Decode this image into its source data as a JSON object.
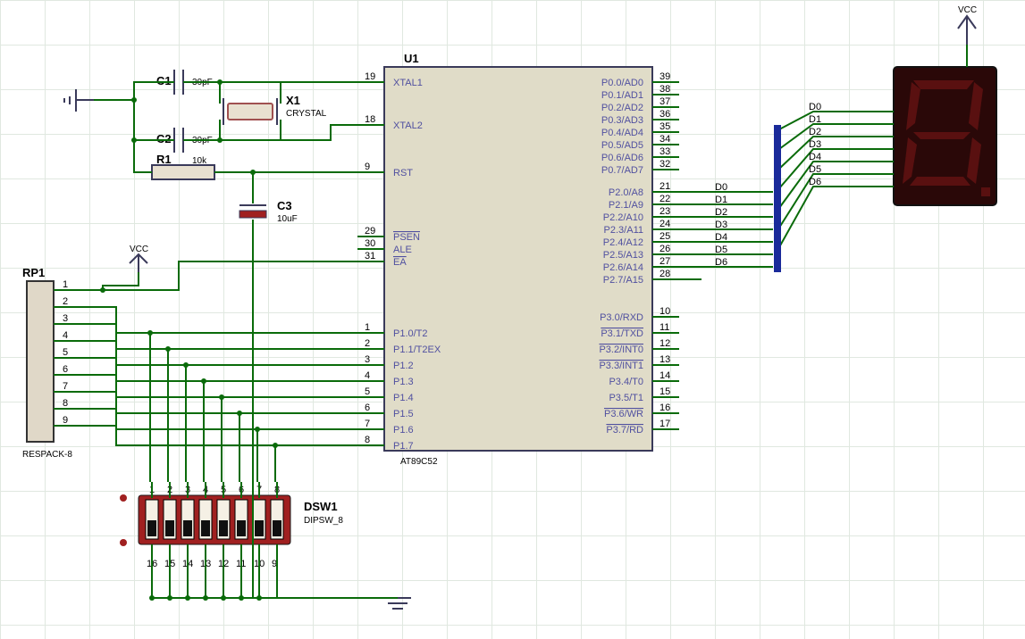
{
  "power": {
    "vcc_top": "VCC",
    "vcc_left": "VCC"
  },
  "mcu": {
    "ref": "U1",
    "part": "AT89C52",
    "left_pins": [
      {
        "num": "19",
        "name": "XTAL1"
      },
      {
        "num": "18",
        "name": "XTAL2"
      },
      {
        "num": "9",
        "name": "RST"
      },
      {
        "num": "29",
        "name": "PSEN",
        "ov": true
      },
      {
        "num": "30",
        "name": "ALE"
      },
      {
        "num": "31",
        "name": "EA",
        "ov": true
      },
      {
        "num": "1",
        "name": "P1.0/T2"
      },
      {
        "num": "2",
        "name": "P1.1/T2EX"
      },
      {
        "num": "3",
        "name": "P1.2"
      },
      {
        "num": "4",
        "name": "P1.3"
      },
      {
        "num": "5",
        "name": "P1.4"
      },
      {
        "num": "6",
        "name": "P1.5"
      },
      {
        "num": "7",
        "name": "P1.6"
      },
      {
        "num": "8",
        "name": "P1.7"
      }
    ],
    "right_pins": [
      {
        "num": "39",
        "name": "P0.0/AD0"
      },
      {
        "num": "38",
        "name": "P0.1/AD1"
      },
      {
        "num": "37",
        "name": "P0.2/AD2"
      },
      {
        "num": "36",
        "name": "P0.3/AD3"
      },
      {
        "num": "35",
        "name": "P0.4/AD4"
      },
      {
        "num": "34",
        "name": "P0.5/AD5"
      },
      {
        "num": "33",
        "name": "P0.6/AD6"
      },
      {
        "num": "32",
        "name": "P0.7/AD7"
      },
      {
        "num": "21",
        "name": "P2.0/A8"
      },
      {
        "num": "22",
        "name": "P2.1/A9"
      },
      {
        "num": "23",
        "name": "P2.2/A10"
      },
      {
        "num": "24",
        "name": "P2.3/A11"
      },
      {
        "num": "25",
        "name": "P2.4/A12"
      },
      {
        "num": "26",
        "name": "P2.5/A13"
      },
      {
        "num": "27",
        "name": "P2.6/A14"
      },
      {
        "num": "28",
        "name": "P2.7/A15"
      },
      {
        "num": "10",
        "name": "P3.0/RXD"
      },
      {
        "num": "11",
        "name": "P3.1/TXD",
        "ov": true
      },
      {
        "num": "12",
        "name": "P3.2/INT0",
        "ov": true
      },
      {
        "num": "13",
        "name": "P3.3/INT1",
        "ov": true
      },
      {
        "num": "14",
        "name": "P3.4/T0"
      },
      {
        "num": "15",
        "name": "P3.5/T1"
      },
      {
        "num": "16",
        "name": "P3.6/WR",
        "ov": true
      },
      {
        "num": "17",
        "name": "P3.7/RD",
        "ov": true
      }
    ]
  },
  "c1": {
    "ref": "C1",
    "val": "30pF"
  },
  "c2": {
    "ref": "C2",
    "val": "30pF"
  },
  "c3": {
    "ref": "C3",
    "val": "10uF"
  },
  "r1": {
    "ref": "R1",
    "val": "10k"
  },
  "x1": {
    "ref": "X1",
    "val": "CRYSTAL"
  },
  "rp1": {
    "ref": "RP1",
    "val": "RESPACK-8",
    "pins": [
      "1",
      "2",
      "3",
      "4",
      "5",
      "6",
      "7",
      "8",
      "9"
    ]
  },
  "dsw1": {
    "ref": "DSW1",
    "val": "DIPSW_8",
    "top": [
      "1",
      "2",
      "3",
      "4",
      "5",
      "6",
      "7",
      "8"
    ],
    "bot": [
      "16",
      "15",
      "14",
      "13",
      "12",
      "11",
      "10",
      "9"
    ]
  },
  "dbus": {
    "upper": [
      "D0",
      "D1",
      "D2",
      "D3",
      "D4",
      "D5",
      "D6"
    ],
    "lower": [
      "D0",
      "D1",
      "D2",
      "D3",
      "D4",
      "D5",
      "D6"
    ]
  }
}
